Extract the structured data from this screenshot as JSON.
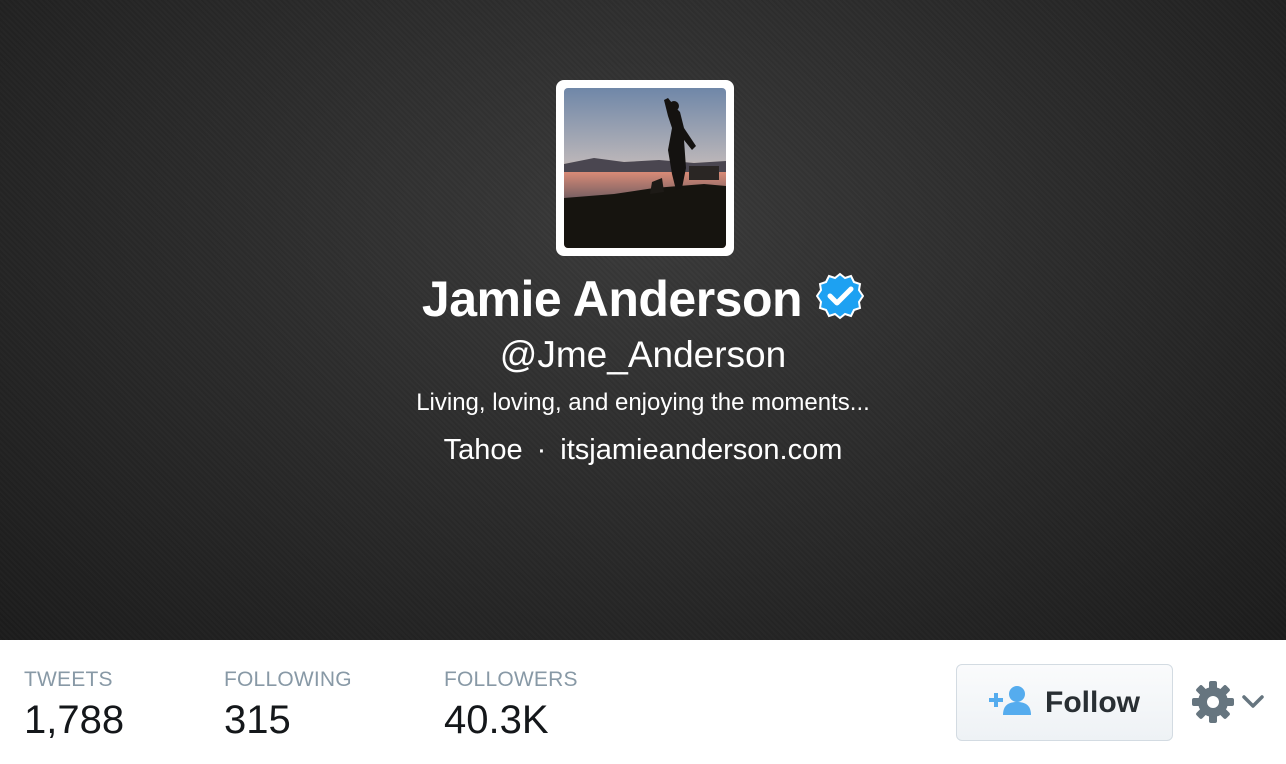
{
  "profile": {
    "name": "Jamie Anderson",
    "handle": "@Jme_Anderson",
    "bio": "Living, loving, and enjoying the moments...",
    "location": "Tahoe",
    "separator": "·",
    "website": "itsjamieanderson.com",
    "verified": true
  },
  "stats": [
    {
      "label": "TWEETS",
      "value": "1,788"
    },
    {
      "label": "FOLLOWING",
      "value": "315"
    },
    {
      "label": "FOLLOWERS",
      "value": "40.3K"
    }
  ],
  "actions": {
    "follow_label": "Follow",
    "follow_icon": "add-user-icon",
    "settings_icon": "gear-icon"
  },
  "colors": {
    "verified": "#1da1f2",
    "follow_icon": "#55acee"
  }
}
